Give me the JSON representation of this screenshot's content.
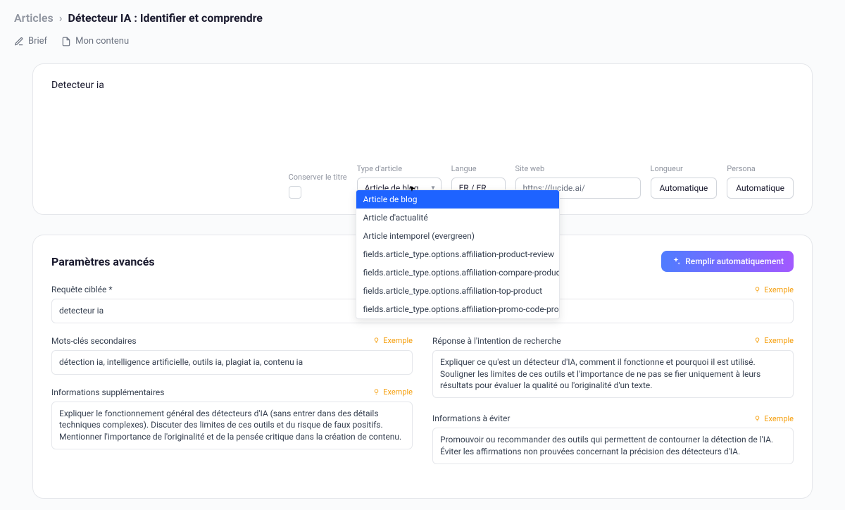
{
  "breadcrumb": {
    "root": "Articles",
    "sep": "›",
    "title": "Détecteur IA : Identifier et comprendre"
  },
  "tabs": {
    "brief": "Brief",
    "content": "Mon contenu"
  },
  "card": {
    "title_value": "Detecteur ia",
    "labels": {
      "keep_title": "Conserver le titre",
      "article_type": "Type d'article",
      "language": "Langue",
      "website": "Site web",
      "length": "Longueur",
      "persona": "Persona"
    },
    "values": {
      "article_type": "Article de blog",
      "language": "FR / FR",
      "website": "https://lucide.ai/",
      "length": "Automatique",
      "persona": "Automatique"
    },
    "dropdown": [
      "Article de blog",
      "Article d'actualité",
      "Article intemporel (evergreen)",
      "fields.article_type.options.affiliation-product-review",
      "fields.article_type.options.affiliation-compare-products",
      "fields.article_type.options.affiliation-top-product",
      "fields.article_type.options.affiliation-promo-code-product"
    ]
  },
  "advanced": {
    "title": "Paramètres avancés",
    "fill_button": "Remplir automatiquement",
    "example_label": "Exemple",
    "fields": {
      "query": {
        "label": "Requête ciblée *",
        "value": "detecteur ia"
      },
      "keywords": {
        "label": "Mots-clés secondaires",
        "value": "détection ia, intelligence artificielle, outils ia, plagiat ia, contenu ia"
      },
      "intent": {
        "label": "Réponse à l'intention de recherche",
        "value": "Expliquer ce qu'est un détecteur d'IA, comment il fonctionne et pourquoi il est utilisé. Souligner les limites de ces outils et l'importance de ne pas se fier uniquement à leurs résultats pour évaluer la qualité ou l'originalité d'un texte."
      },
      "extra": {
        "label": "Informations supplémentaires",
        "value": "Expliquer le fonctionnement général des détecteurs d'IA (sans entrer dans des détails techniques complexes). Discuter des limites de ces outils et du risque de faux positifs. Mentionner l'importance de l'originalité et de la pensée critique dans la création de contenu."
      },
      "avoid": {
        "label": "Informations à éviter",
        "value": "Promouvoir ou recommander des outils qui permettent de contourner la détection de l'IA. Éviter les affirmations non prouvées concernant la précision des détecteurs d'IA."
      }
    }
  }
}
